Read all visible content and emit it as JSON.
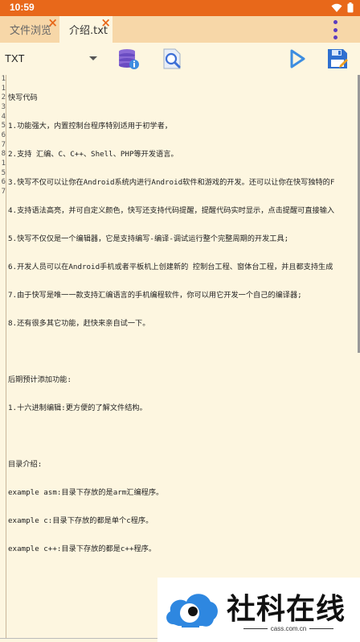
{
  "status_bar": {
    "time": "10:59"
  },
  "tabs": [
    {
      "label": "文件浏览",
      "active": false
    },
    {
      "label": "介绍.txt",
      "active": true
    }
  ],
  "toolbar": {
    "language": "TXT",
    "buttons": [
      "database-info-icon",
      "search-icon",
      "run-icon",
      "save-edit-icon"
    ]
  },
  "editor": {
    "line_numbers": [
      "1",
      "1",
      "2",
      "3",
      "4",
      "5",
      "6",
      "7",
      "8",
      "",
      "",
      "1",
      "",
      "",
      "5",
      "6",
      "7"
    ],
    "lines": [
      "快写代码",
      "1.功能强大，内置控制台程序特别适用于初学者，",
      "2.支持 汇编、C、C++、Shell、PHP等开发语言。",
      "3.快写不仅可以让你在Android系统内进行Android软件和游戏的开发。还可以让你在快写独特的F",
      "4.支持语法高亮，并可自定义颜色，快写还支持代码提醒，提醒代码实时显示，点击提醒可直接输入",
      "5.快写不仅仅是一个编辑器，它是支持编写-编译-调试运行整个完整周期的开发工具;",
      "6.开发人员可以在Android手机或者平板机上创建新的 控制台工程、窗体台工程，并且都支持生成",
      "7.由于快写是唯一一款支持汇编语言的手机编程软件，你可以用它开发一个自己的编译器;",
      "8.还有很多其它功能，赶快来亲自试一下。",
      "",
      "后期预计添加功能:",
      "1.十六进制编辑:更方便的了解文件结构。",
      "",
      "目录介绍:",
      "example asm:目录下存放的是arm汇编程序。",
      "example c:目录下存放的都是单个c程序。",
      "example c++:目录下存放的都是c++程序。"
    ]
  },
  "watermark": {
    "title": "社科在线",
    "domain": "cass.com.cn"
  },
  "colors": {
    "status_bar": "#e8681a",
    "tab_bar": "#f7d7a8",
    "background": "#fdf6e0",
    "accent": "#3d8de0"
  }
}
